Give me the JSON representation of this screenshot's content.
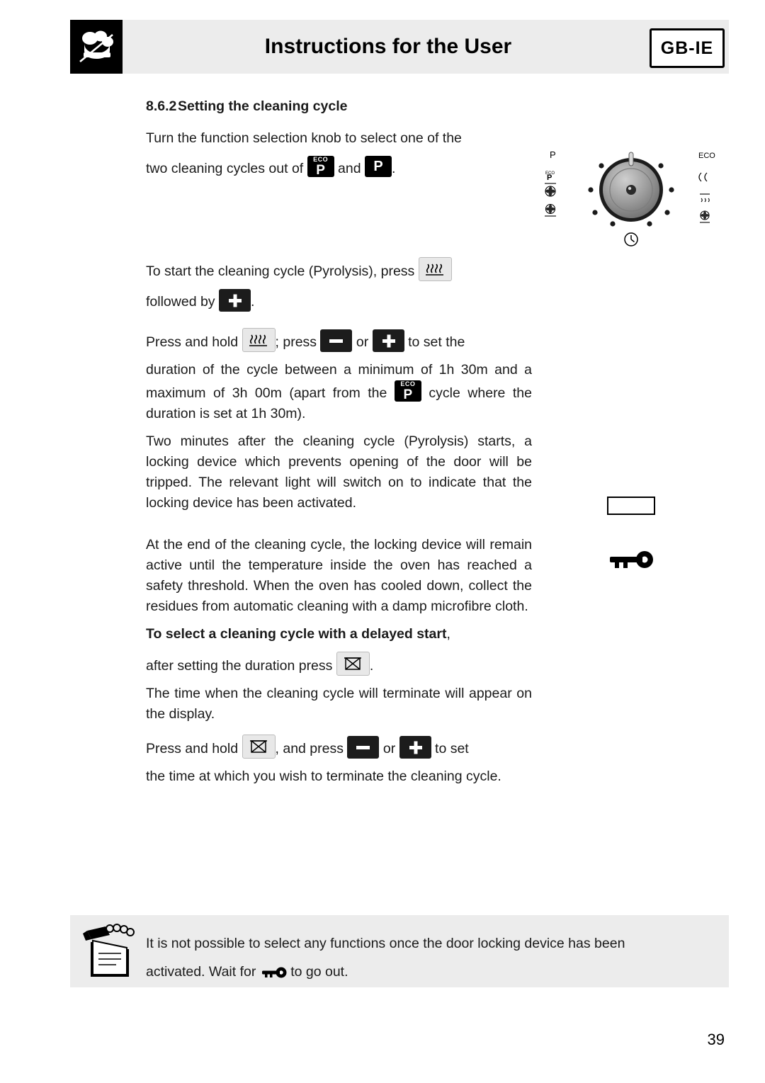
{
  "header": {
    "title": "Instructions for the User",
    "badge": "GB-IE",
    "logo_icon": "chef-hat-icon"
  },
  "section": {
    "number": "8.6.2",
    "title": "Setting the cleaning cycle"
  },
  "body": {
    "p1_a": "Turn the function selection knob to select one of the",
    "p1_b": "two cleaning cycles out of",
    "p1_and": "and",
    "p1_end": ".",
    "p2_a": "To start the cleaning cycle (Pyrolysis), press",
    "p2_b": "followed by",
    "p2_end": ".",
    "p3_a": "Press and hold",
    "p3_b": "; press",
    "p3_or": "or",
    "p3_c": "to set the",
    "p3_d": "duration of the cycle between a minimum of 1h 30m and a maximum of 3h 00m (apart from the",
    "p3_e": "cycle where the duration is set at 1h 30m).",
    "p4": "Two minutes after the cleaning cycle (Pyrolysis) starts, a locking device which prevents opening of the door will be tripped. The relevant light will switch on to indicate that the locking device has been activated.",
    "p5": "At the end of the cleaning cycle, the locking device will remain active until the temperature inside the oven has reached a safety threshold. When the oven has cooled down, collect the residues from automatic cleaning with a damp microfibre cloth.",
    "p6_bold": "To select a cleaning cycle with a delayed start",
    "p6_rest": ",",
    "p7_a": "after setting the duration press",
    "p7_end": ".",
    "p8": "The time when the cleaning cycle will terminate will appear on the display.",
    "p9_a": "Press and hold",
    "p9_b": ", and press",
    "p9_or": "or",
    "p9_c": "to set",
    "p9_d": "the time at which you wish to terminate the cleaning cycle."
  },
  "keys": {
    "eco_label": "ECO",
    "p_label": "P",
    "pyro_icon": "pyrolysis-heat-icon",
    "minus_icon": "minus-icon",
    "plus_icon": "plus-icon",
    "timer_end_icon": "cooking-end-time-icon"
  },
  "knob": {
    "label_p": "P",
    "label_eco": "ECO",
    "icon_left_top": "eco-pyro-icon",
    "icon_left_mid": "fan-grill-icon",
    "icon_left_bot": "fan-bottom-icon",
    "icon_right_top": "defrost-icon",
    "icon_right_mid": "grill-icon",
    "icon_right_bot": "bottom-heat-icon",
    "icon_bottom": "power-off-icon"
  },
  "graphics": {
    "display_box": "oven-display-box",
    "lock_key_icon": "door-lock-key-icon"
  },
  "note": {
    "icon": "note-pencil-icon",
    "text_a": "It is not possible to select any functions once the door locking device has been",
    "text_b": "activated. Wait for",
    "text_c": "to go out.",
    "key_icon": "door-lock-key-icon"
  },
  "footer": {
    "page_number": "39"
  },
  "colors": {
    "band": "#ececec",
    "key_dark": "#1c1c1c",
    "text": "#1a1a1a"
  }
}
